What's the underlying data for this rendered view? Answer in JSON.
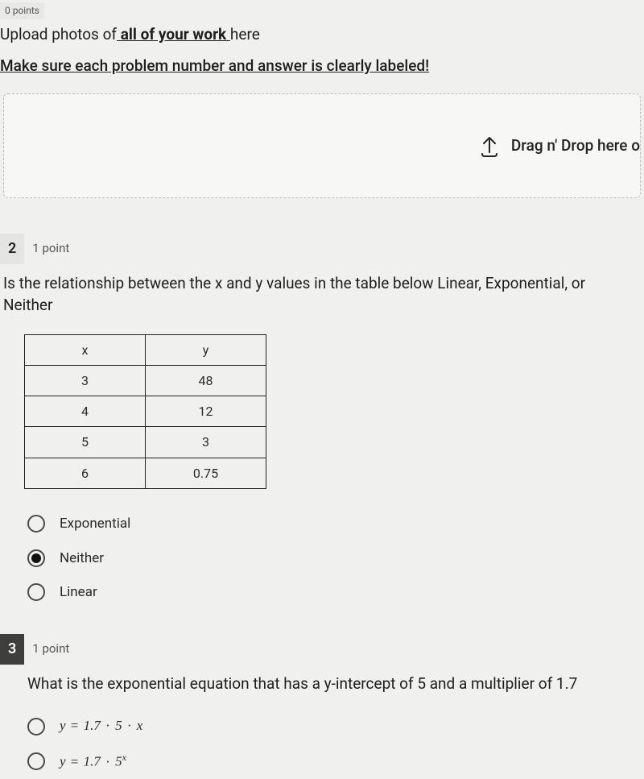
{
  "top": {
    "points_tag": "0 points",
    "line1_pre": "Upload photos of",
    "line1_und": " all of your work ",
    "line1_post": "here",
    "line2": "Make sure each problem number and answer is clearly labeled!",
    "drop_text": "Drag n' Drop here o"
  },
  "q2": {
    "number": "2",
    "points": "1 point",
    "stem": "Is the relationship between the x and y values in the table below Linear, Exponential, or Neither",
    "table": {
      "headers": [
        "x",
        "y"
      ],
      "rows": [
        [
          "3",
          "48"
        ],
        [
          "4",
          "12"
        ],
        [
          "5",
          "3"
        ],
        [
          "6",
          "0.75"
        ]
      ]
    },
    "choices": [
      {
        "label": "Exponential",
        "selected": false
      },
      {
        "label": "Neither",
        "selected": true
      },
      {
        "label": "Linear",
        "selected": false
      }
    ]
  },
  "q3": {
    "number": "3",
    "points": "1 point",
    "stem": "What is the exponential equation that has a y-intercept of 5 and a multiplier of 1.7",
    "choices": [
      {
        "expr": "y = 1.7 · 5 · x",
        "selected": false
      },
      {
        "expr": "y = 1.7 · 5^x",
        "selected": false
      }
    ]
  }
}
